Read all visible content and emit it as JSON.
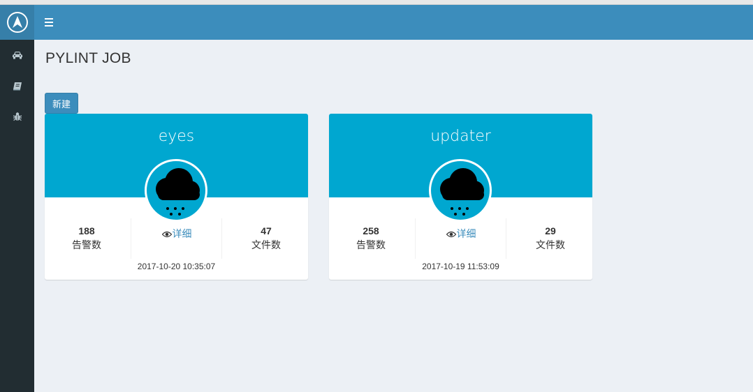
{
  "page": {
    "title": "PYLINT JOB"
  },
  "toolbar": {
    "new_label": "新建"
  },
  "sidebar": {
    "items": [
      {
        "icon": "car-icon"
      },
      {
        "icon": "book-icon"
      },
      {
        "icon": "bug-icon"
      }
    ]
  },
  "colors": {
    "header": "#3c8dbc",
    "sidebar": "#222d32",
    "card_header": "#00a7d0",
    "link": "#3c8dbc"
  },
  "jobs": [
    {
      "name": "eyes",
      "warnings": "188",
      "warnings_label": "告警数",
      "detail_label": "详细",
      "files": "47",
      "files_label": "文件数",
      "time": "2017-10-20 10:35:07",
      "icon": "snow-cloud-icon"
    },
    {
      "name": "updater",
      "warnings": "258",
      "warnings_label": "告警数",
      "detail_label": "详细",
      "files": "29",
      "files_label": "文件数",
      "time": "2017-10-19 11:53:09",
      "icon": "snow-cloud-icon"
    }
  ]
}
